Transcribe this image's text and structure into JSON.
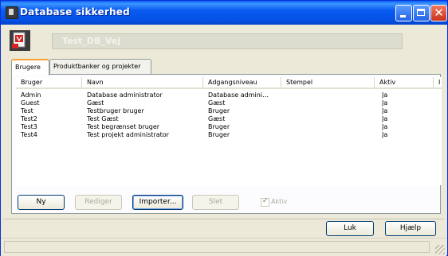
{
  "window": {
    "title": "Database sikkerhed",
    "database_name": "Test_DB_Vej"
  },
  "icons": {
    "title": "app-database-icon",
    "header": "database-security-icon",
    "minimize": "minimize-icon",
    "maximize": "maximize-icon",
    "close": "close-icon",
    "checkmark": "checkmark-icon",
    "resize": "resize-grip-icon"
  },
  "tabs": [
    {
      "label": "Brugere",
      "active": true
    },
    {
      "label": "Produktbanker og projekter",
      "active": false
    }
  ],
  "table": {
    "columns": [
      "Bruger",
      "Navn",
      "Adgangsniveau",
      "Stempel",
      "Aktiv",
      "I"
    ],
    "rows": [
      {
        "bruger": "Admin",
        "navn": "Database administrator",
        "niveau": "Database admini…",
        "stempel": "",
        "aktiv": "Ja"
      },
      {
        "bruger": "Guest",
        "navn": "Gæst",
        "niveau": "Gæst",
        "stempel": "",
        "aktiv": "Ja"
      },
      {
        "bruger": "Test",
        "navn": "Testbruger bruger",
        "niveau": "Bruger",
        "stempel": "",
        "aktiv": "Ja"
      },
      {
        "bruger": "Test2",
        "navn": "Test Gæst",
        "niveau": "Gæst",
        "stempel": "",
        "aktiv": "Ja"
      },
      {
        "bruger": "Test3",
        "navn": "Test begrænset bruger",
        "niveau": "Bruger",
        "stempel": "",
        "aktiv": "Ja"
      },
      {
        "bruger": "Test4",
        "navn": "Test projekt administrator",
        "niveau": "Bruger",
        "stempel": "",
        "aktiv": "Ja"
      }
    ]
  },
  "actions": {
    "new": "Ny",
    "edit": "Rediger",
    "import": "Importer...",
    "delete": "Slet",
    "active_checkbox": "Aktiv",
    "active_checked": true
  },
  "footer": {
    "close": "Luk",
    "help": "Hjælp"
  },
  "colors": {
    "titlebar": "#0a5bf0",
    "accent_tab": "#f9a436",
    "close_button": "#c8321b"
  }
}
